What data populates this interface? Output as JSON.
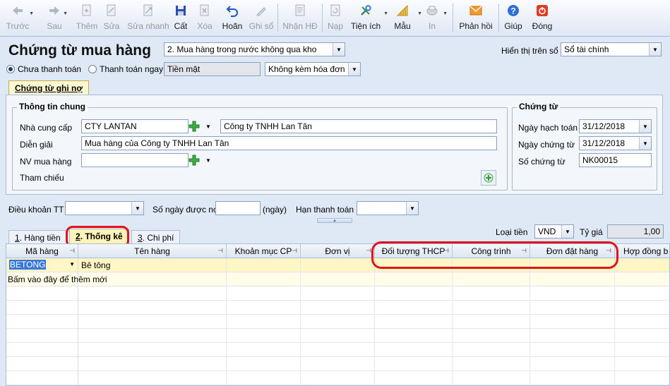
{
  "toolbar": {
    "items": [
      {
        "label": "Trước",
        "icon": "arrow-left-icon",
        "enabled": false,
        "dropdown": true
      },
      {
        "label": "Sau",
        "icon": "arrow-right-icon",
        "enabled": false,
        "dropdown": true
      },
      {
        "label": "Thêm",
        "icon": "add-document-icon",
        "enabled": false
      },
      {
        "label": "Sửa",
        "icon": "edit-document-icon",
        "enabled": false
      },
      {
        "label": "Sửa nhanh",
        "icon": "quick-edit-icon",
        "enabled": false
      },
      {
        "label": "Cất",
        "icon": "save-disk-icon",
        "enabled": true
      },
      {
        "label": "Xóa",
        "icon": "delete-document-icon",
        "enabled": false
      },
      {
        "label": "Hoãn",
        "icon": "undo-icon",
        "enabled": true
      },
      {
        "label": "Ghi sổ",
        "icon": "pencil-icon",
        "enabled": false
      },
      {
        "label": "Nhận HĐ",
        "icon": "receive-invoice-icon",
        "enabled": false
      },
      {
        "label": "Nạp",
        "icon": "reload-icon",
        "enabled": false
      },
      {
        "label": "Tiện ích",
        "icon": "tools-icon",
        "enabled": true,
        "dropdown": true
      },
      {
        "label": "Mẫu",
        "icon": "template-icon",
        "enabled": true,
        "dropdown": true
      },
      {
        "label": "In",
        "icon": "print-icon",
        "enabled": false,
        "dropdown": true
      },
      {
        "label": "Phản hồi",
        "icon": "feedback-mail-icon",
        "enabled": true
      },
      {
        "label": "Giúp",
        "icon": "help-icon",
        "enabled": true
      },
      {
        "label": "Đóng",
        "icon": "close-power-icon",
        "enabled": true
      }
    ]
  },
  "header": {
    "title": "Chứng từ mua hàng",
    "type_select": "2. Mua hàng trong nước không qua kho",
    "display_label": "Hiển thị trên sổ",
    "display_select": "Sổ tài chính",
    "radio_unpaid": "Chưa thanh toán",
    "radio_paid": "Thanh toán ngay",
    "payment_method": "Tiền mặt",
    "invoice_select": "Không kèm hóa đơn"
  },
  "doc_tab": "Chứng từ ghi nợ",
  "general": {
    "title": "Thông tin chung",
    "supplier_label": "Nhà cung cấp",
    "supplier_code": "CTY LANTAN",
    "supplier_name": "Công ty TNHH Lan Tân",
    "desc_label": "Diễn giải",
    "desc_value": "Mua hàng của Công ty TNHH Lan Tân",
    "buyer_label": "NV mua hàng",
    "buyer_value": "",
    "ref_label": "Tham chiếu"
  },
  "voucher": {
    "title": "Chứng từ",
    "post_date_label": "Ngày hạch toán",
    "post_date": "31/12/2018",
    "doc_date_label": "Ngày chứng từ",
    "doc_date": "31/12/2018",
    "doc_no_label": "Số chứng từ",
    "doc_no": "NK00015"
  },
  "terms": {
    "terms_label": "Điều khoản TT",
    "days_label": "Số ngày được nợ",
    "days_unit": "(ngày)",
    "due_label": "Hạn thanh toán"
  },
  "tabs": [
    {
      "num": "1",
      "rest": ". Hàng tiền"
    },
    {
      "num": "2",
      "rest": ". Thống kê"
    },
    {
      "num": "3",
      "rest": ". Chi phí"
    }
  ],
  "currency": {
    "label": "Loại tiền",
    "value": "VND",
    "rate_label": "Tỷ giá",
    "rate": "1,00"
  },
  "grid": {
    "columns": [
      "Mã hàng",
      "Tên hàng",
      "Khoản mục CP",
      "Đơn vị",
      "Đối tượng THCP",
      "Công trình",
      "Đơn đặt hàng",
      "Hợp đồng b"
    ],
    "rows": [
      {
        "code": "BETONG",
        "name": "Bê tông"
      }
    ],
    "add_hint": "Bấm vào đây để thêm mới"
  },
  "colors": {
    "highlight": "#e0141e",
    "active_tab": "#fff4b8",
    "row_selected": "#fff6c6"
  }
}
